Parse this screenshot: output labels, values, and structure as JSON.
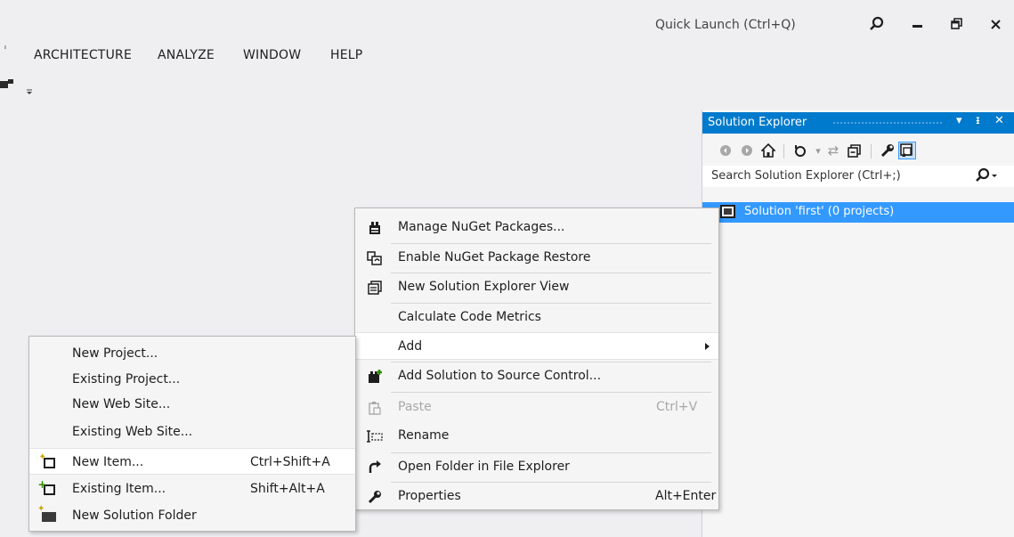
{
  "titlebar": {
    "quick_launch_placeholder": "Quick Launch (Ctrl+Q)",
    "search_icon": "search-icon",
    "minimize_icon": "minimize-icon",
    "restore_icon": "restore-icon",
    "close_icon": "close-icon"
  },
  "menubar": {
    "items": [
      "ARCHITECTURE",
      "ANALYZE",
      "WINDOW",
      "HELP"
    ]
  },
  "solution_explorer": {
    "title": "Solution Explorer",
    "search_placeholder": "Search Solution Explorer (Ctrl+;)",
    "root_node": "Solution 'first' (0 projects)",
    "toolbar_icons": [
      "back-icon",
      "forward-icon",
      "home-icon",
      "sync-icon",
      "pending-changes-icon",
      "collapse-all-icon",
      "properties-icon",
      "show-all-files-icon"
    ],
    "accent_color": "#007acc",
    "selection_color": "#3399ff"
  },
  "context_menu": {
    "items": [
      {
        "label": "Manage NuGet Packages...",
        "icon": "nuget-icon",
        "shortcut": ""
      },
      {
        "label": "Enable NuGet Package Restore",
        "icon": "package-restore-icon",
        "shortcut": ""
      },
      {
        "label": "New Solution Explorer View",
        "icon": "new-view-icon",
        "shortcut": ""
      },
      {
        "label": "Calculate Code Metrics",
        "icon": "",
        "shortcut": ""
      },
      {
        "label": "Add",
        "icon": "",
        "shortcut": "",
        "submenu": true,
        "highlighted": true
      },
      {
        "label": "Add Solution to Source Control...",
        "icon": "source-control-icon",
        "shortcut": ""
      },
      {
        "label": "Paste",
        "icon": "paste-icon",
        "shortcut": "Ctrl+V",
        "disabled": true
      },
      {
        "label": "Rename",
        "icon": "rename-icon",
        "shortcut": ""
      },
      {
        "label": "Open Folder in File Explorer",
        "icon": "open-folder-icon",
        "shortcut": ""
      },
      {
        "label": "Properties",
        "icon": "wrench-icon",
        "shortcut": "Alt+Enter"
      }
    ]
  },
  "add_submenu": {
    "items": [
      {
        "label": "New Project...",
        "icon": "",
        "shortcut": ""
      },
      {
        "label": "Existing Project...",
        "icon": "",
        "shortcut": ""
      },
      {
        "label": "New Web Site...",
        "icon": "",
        "shortcut": ""
      },
      {
        "label": "Existing Web Site...",
        "icon": "",
        "shortcut": ""
      },
      {
        "label": "New Item...",
        "icon": "new-item-icon",
        "shortcut": "Ctrl+Shift+A",
        "highlighted": true
      },
      {
        "label": "Existing Item...",
        "icon": "existing-item-icon",
        "shortcut": "Shift+Alt+A"
      },
      {
        "label": "New Solution Folder",
        "icon": "new-solution-folder-icon",
        "shortcut": ""
      }
    ]
  }
}
